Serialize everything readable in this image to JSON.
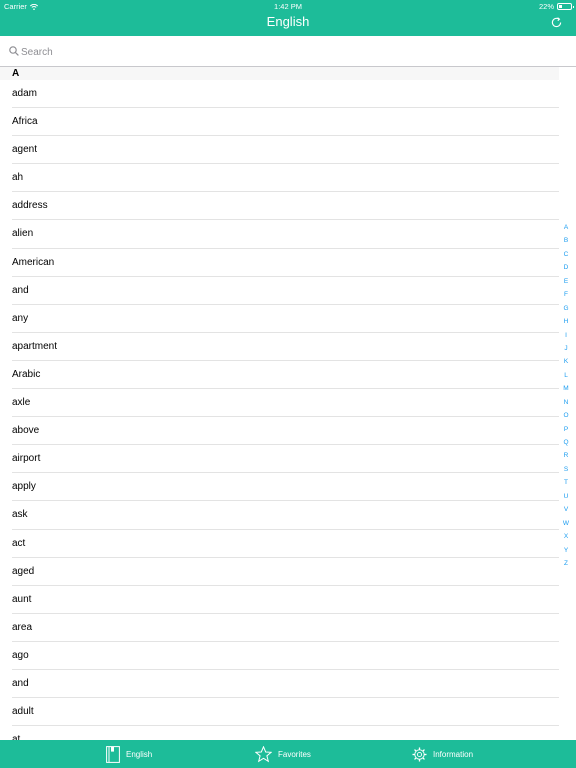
{
  "status_bar": {
    "carrier": "Carrier",
    "time": "1:42 PM",
    "battery": "22%"
  },
  "nav": {
    "title": "English",
    "refresh_icon": "refresh-icon"
  },
  "search": {
    "placeholder": "Search",
    "value": ""
  },
  "list": {
    "section_header": "A",
    "items": [
      "adam",
      "Africa",
      "agent",
      "ah",
      "address",
      "alien",
      "American",
      "and",
      "any",
      "apartment",
      "Arabic",
      "axle",
      "above",
      "airport",
      "apply",
      "ask",
      "act",
      "aged",
      "aunt",
      "area",
      "ago",
      "and",
      "adult",
      "at"
    ]
  },
  "index_letters": [
    "A",
    "B",
    "C",
    "D",
    "E",
    "F",
    "G",
    "H",
    "I",
    "J",
    "K",
    "L",
    "M",
    "N",
    "O",
    "P",
    "Q",
    "R",
    "S",
    "T",
    "U",
    "V",
    "W",
    "X",
    "Y",
    "Z"
  ],
  "tabs": [
    {
      "label": "English",
      "icon": "book-icon"
    },
    {
      "label": "Favorites",
      "icon": "star-icon"
    },
    {
      "label": "Information",
      "icon": "gear-icon"
    }
  ],
  "colors": {
    "accent": "#1dbc99",
    "index": "#1a9cf0"
  }
}
